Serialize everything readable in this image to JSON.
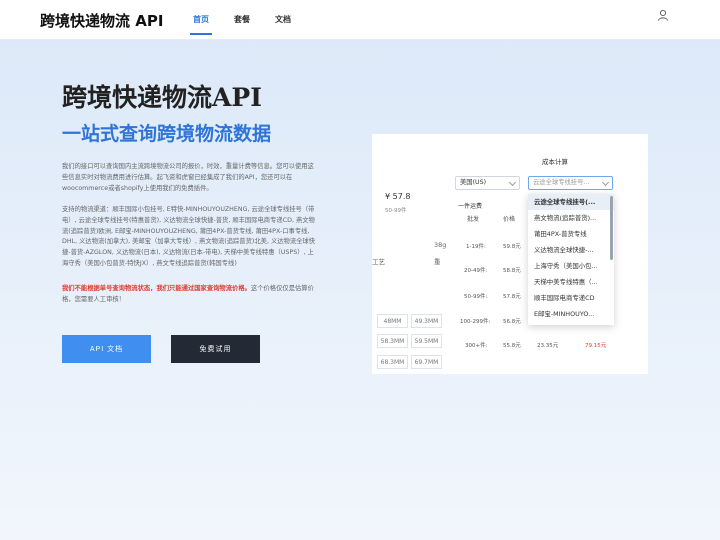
{
  "nav": {
    "brand": "跨境快递物流 API",
    "items": [
      "首页",
      "套餐",
      "文档"
    ]
  },
  "hero": {
    "title": "跨境快递物流API",
    "subtitle": "一站式查询跨境物流数据",
    "desc1": "我们的接口可以查询国内主流跨境物流公司的报价，时效，重量计费等信息。您可以使用这些信息实时对物流费用进行估算。起飞资和虎窗已经集成了我们的API，您还可以在woocommerce或者shopify上使用我们的免费插件。",
    "desc2": "支持的物流渠道：顺丰国际小包挂号, E特快-MINHOUYOUZHENG, 云途全球专线挂号（带电）, 云途全球专线挂号(特惠普货), 义达物流全球快捷-普货, 顺丰国际电商专递CD, 燕文物流(追踪普货)欧洲, E邮宝-MINHOUYOUZHENG, 莆田4PX-普货专线, 莆田4PX-口事专线, DHL, 义达物流(加拿大), 美邮宝（加拿大专线）, 燕文物流(追踪普货)北美, 义达物流全球快捷-普货-AZGLON, 义达物流(日本), 义达物流(日本-带电), 天梯中美专线特惠（USPS）, 上海守秀（美国小包普货-特快JX）, 燕文专线追踪普货(韩国专线)",
    "warn": "我们不能根据单号查询物流状态，我们只能通过国家查询物流价格。",
    "desc3_tail": "这个价格仅仅是估算价格，您需要人工审核！"
  },
  "buttons": {
    "api": "API 文档",
    "trial": "免费试用"
  },
  "card": {
    "calc_label": "成本计算",
    "country": "美国(US)",
    "channel_placeholder": "云途全球专线挂号...",
    "price": "¥ 57.8",
    "price_range": "50-99件",
    "section_label": "一件运费",
    "col_batch": "批发",
    "col_price": "价格",
    "left_peek": "工艺",
    "mid_peek1": "38g",
    "mid_peek2": "重",
    "tiers": [
      {
        "range": "1-19件:",
        "price": "59.8元"
      },
      {
        "range": "20-49件:",
        "price": "58.8元"
      },
      {
        "range": "50-99件:",
        "price": "57.8元"
      },
      {
        "range": "100-299件:",
        "price": "56.8元"
      },
      {
        "range": "300+件:",
        "price": "55.8元",
        "sub": "23.35元",
        "total": "79.15元"
      }
    ],
    "dims": [
      [
        "48MM",
        "49.3MM"
      ],
      [
        "58.3MM",
        "59.5MM"
      ],
      [
        "68.3MM",
        "69.7MM"
      ]
    ],
    "dropdown": [
      "云途全球专线挂号(...",
      "燕文物流(追踪普货)...",
      "莆田4PX-普货专线",
      "义达物流全球快捷-...",
      "上海守秀（美国小包...",
      "天梯中美专线特惠（...",
      "顺丰国际电商专递CD",
      "E邮宝-MINHOUYO..."
    ]
  },
  "colors": {
    "accent": "#2f74d6",
    "button_blue": "#3f8ef0",
    "button_dark": "#232a35",
    "warn": "#e03a2f"
  }
}
